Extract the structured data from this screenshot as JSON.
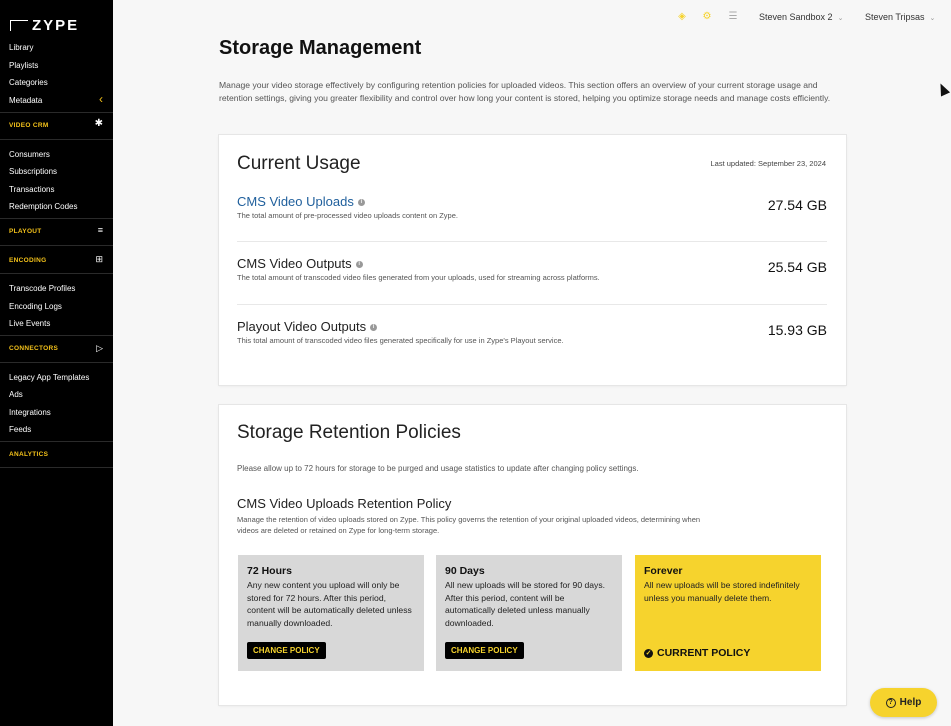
{
  "sidebar": {
    "logo": "ZYPE",
    "items": [
      {
        "label": "Library"
      },
      {
        "label": "Playlists"
      },
      {
        "label": "Categories"
      },
      {
        "label": "Metadata"
      }
    ],
    "sections": {
      "video_crm": "VIDEO CRM",
      "playout": "PLAYOUT",
      "encoding": "ENCODING",
      "connectors": "CONNECTORS",
      "analytics": "ANALYTICS"
    },
    "crm_items": [
      {
        "label": "Consumers"
      },
      {
        "label": "Subscriptions"
      },
      {
        "label": "Transactions"
      },
      {
        "label": "Redemption Codes"
      }
    ],
    "encoding_items": [
      {
        "label": "Transcode Profiles"
      },
      {
        "label": "Encoding Logs"
      },
      {
        "label": "Live Events"
      }
    ],
    "connector_items": [
      {
        "label": "Legacy App Templates"
      },
      {
        "label": "Ads"
      },
      {
        "label": "Integrations"
      },
      {
        "label": "Feeds"
      }
    ],
    "icons": {
      "collapse": "chevron-left-icon",
      "video_crm": "asterisk-icon",
      "playout": "lines-icon",
      "encoding": "grid-icon",
      "connectors": "play-icon"
    }
  },
  "topbar": {
    "account": "Steven Sandbox 2",
    "user": "Steven Tripsas"
  },
  "main": {
    "title": "Storage Management",
    "description": "Manage your video storage effectively by configuring retention policies for uploaded videos. This section offers an overview of your current storage usage and retention settings, giving you greater flexibility and control over how long your content is stored, helping you optimize storage needs and manage costs efficiently."
  },
  "usage": {
    "title": "Current Usage",
    "last_updated": "Last updated: September 23, 2024",
    "rows": [
      {
        "name": "CMS Video Uploads",
        "desc": "The total amount of pre-processed video uploads content on Zype.",
        "value": "27.54 GB"
      },
      {
        "name": "CMS Video Outputs",
        "desc": "The total amount of transcoded video files generated from your uploads, used for streaming across platforms.",
        "value": "25.54 GB"
      },
      {
        "name": "Playout Video Outputs",
        "desc": "This total amount of transcoded video files generated specifically for use in Zype's Playout service.",
        "value": "15.93 GB"
      }
    ]
  },
  "retention": {
    "title": "Storage Retention Policies",
    "note": "Please allow up to 72 hours for storage to be purged and usage statistics to update after changing policy settings.",
    "policy_title": "CMS Video Uploads Retention Policy",
    "policy_desc": "Manage the retention of video uploads stored on Zype. This policy governs the retention of your original uploaded videos, determining when videos are deleted or retained on Zype for long-term storage.",
    "options": [
      {
        "title": "72 Hours",
        "text": "Any new content you upload will only be stored for 72 hours. After this period, content will be automatically deleted unless manually downloaded.",
        "action": "CHANGE POLICY"
      },
      {
        "title": "90 Days",
        "text": "All new uploads will be stored for 90 days. After this period, content will be automatically deleted unless manually downloaded.",
        "action": "CHANGE POLICY"
      },
      {
        "title": "Forever",
        "text": "All new uploads will be stored indefinitely unless you manually delete them.",
        "action": "CURRENT POLICY"
      }
    ]
  },
  "help": {
    "label": "Help"
  },
  "colors": {
    "accent": "#f6d32d",
    "sidebar": "#000000",
    "link": "#1f5f9c"
  }
}
